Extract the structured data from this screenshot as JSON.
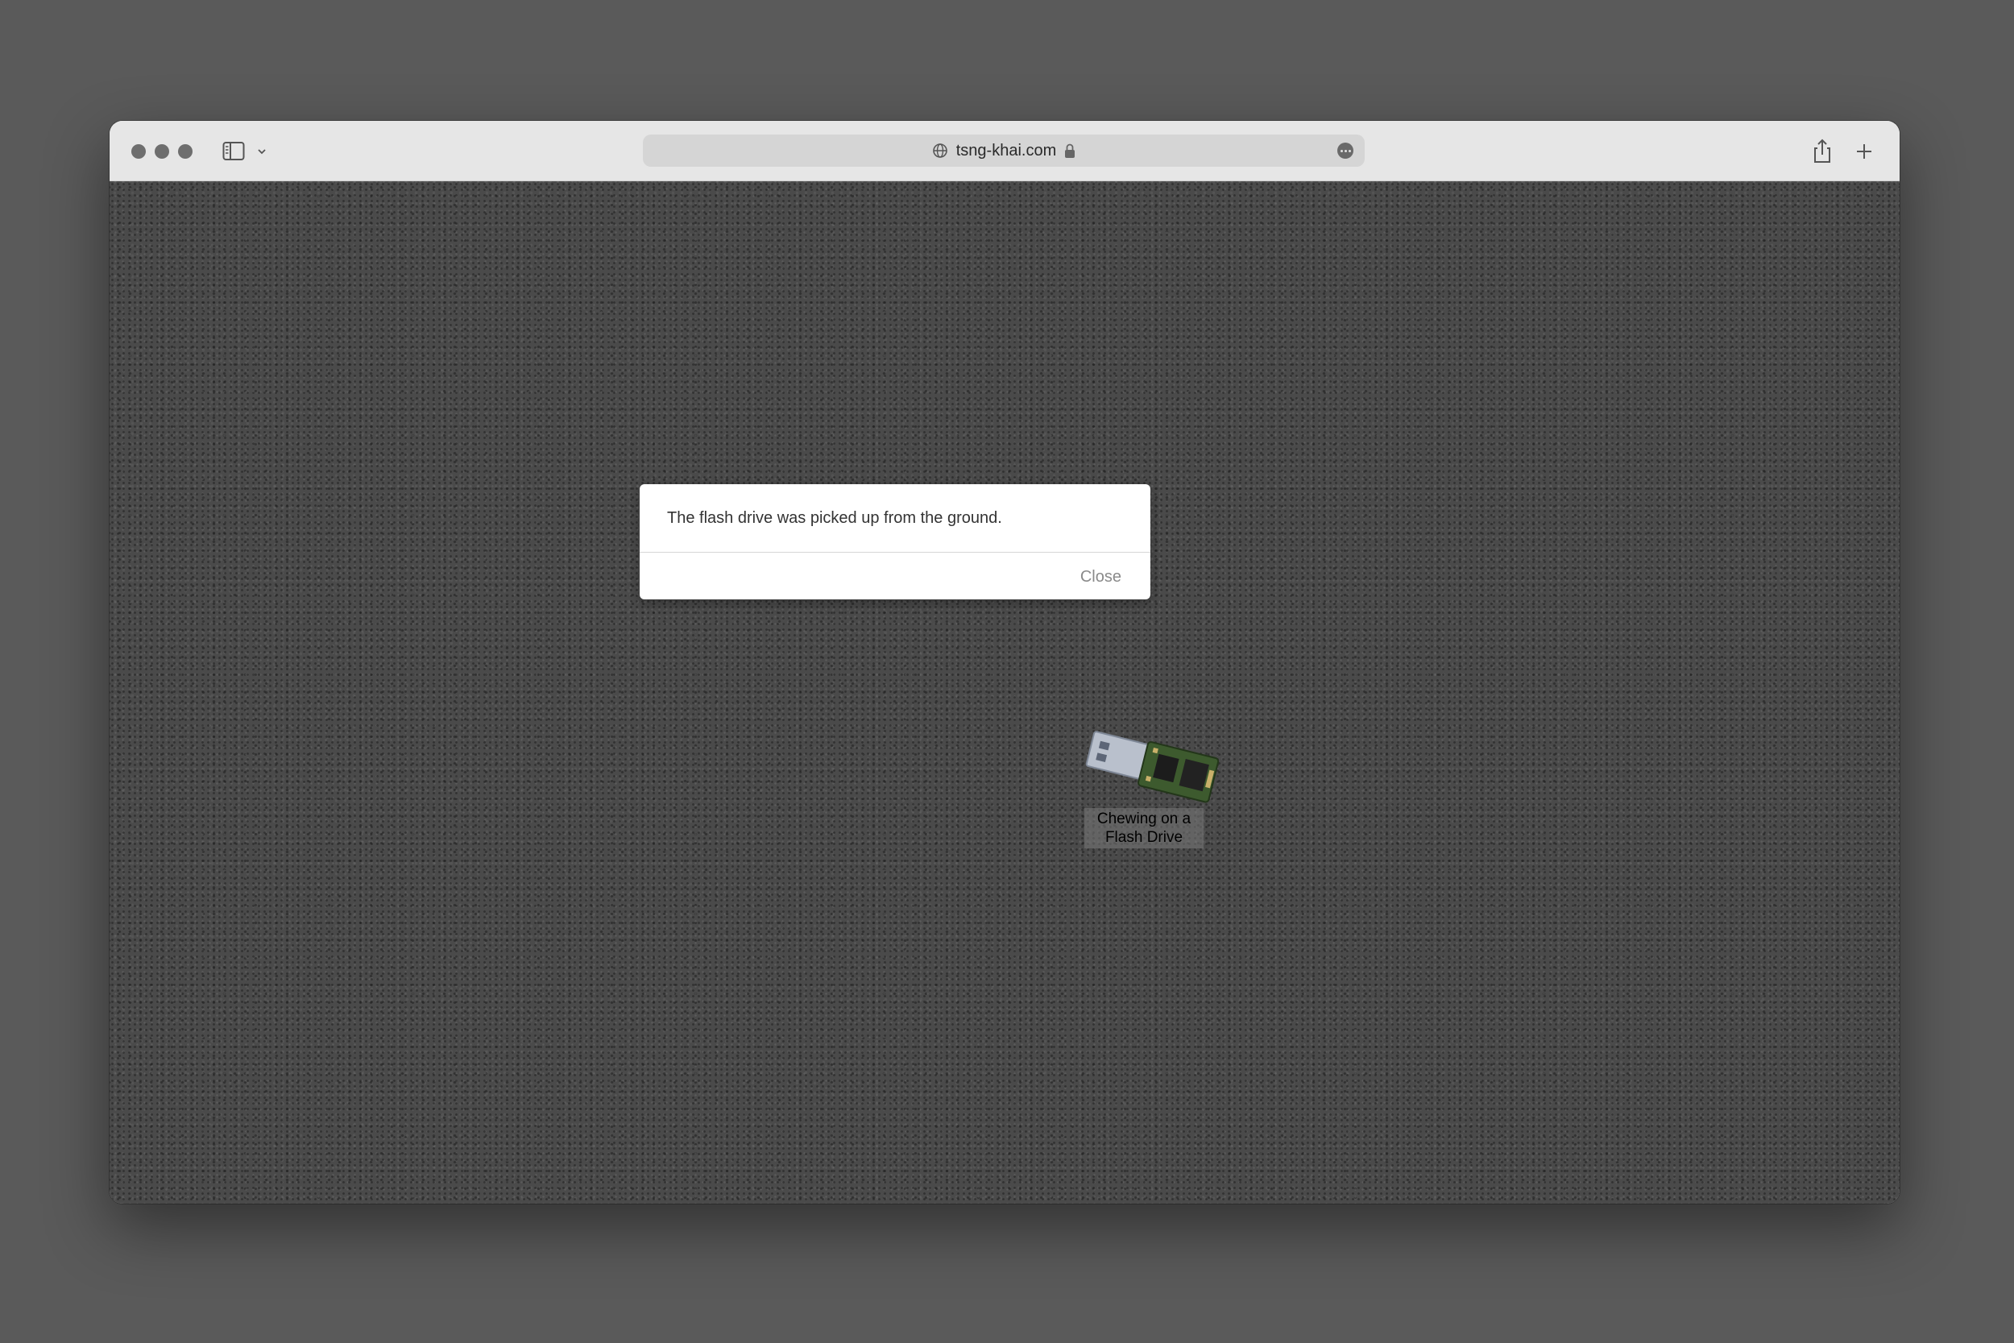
{
  "browser": {
    "url": "tsng-khai.com",
    "icons": {
      "sidebar": "sidebar-icon",
      "chevron": "chevron-down-icon",
      "globe": "globe-icon",
      "lock": "lock-icon",
      "more": "ellipsis-icon",
      "share": "share-icon",
      "new_tab": "plus-icon"
    }
  },
  "dialog": {
    "message": "The flash drive was picked up from the ground.",
    "close_label": "Close"
  },
  "scene": {
    "item_label_line1": "Chewing on a",
    "item_label_line2": "Flash Drive"
  },
  "colors": {
    "page_background": "#5a5a5a",
    "ground": "#4a4a4a",
    "dialog_background": "#ffffff",
    "close_text": "#8a8a8a"
  }
}
